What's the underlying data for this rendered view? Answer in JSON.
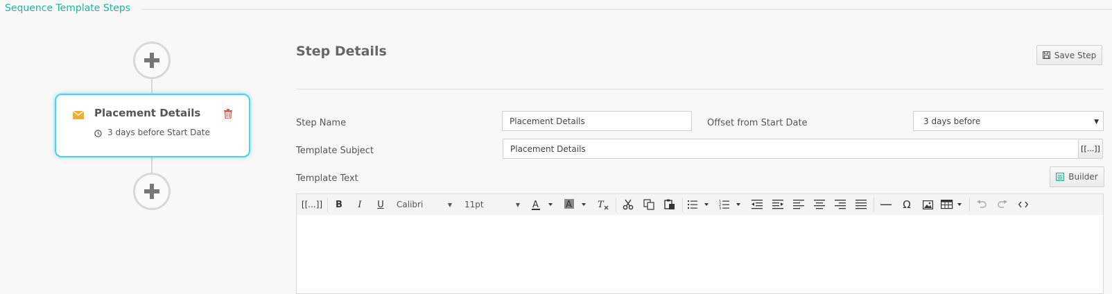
{
  "section": {
    "title": "Sequence Template Steps"
  },
  "steps": [
    {
      "title": "Placement Details",
      "offset_text": "3 days before Start Date"
    }
  ],
  "details": {
    "heading": "Step Details",
    "save_label": "Save Step",
    "step_name_label": "Step Name",
    "step_name_value": "Placement Details",
    "offset_label": "Offset from Start Date",
    "offset_value": "3 days before",
    "subject_label": "Template Subject",
    "subject_value": "Placement Details",
    "merge_label": "[[...]]",
    "text_label": "Template Text",
    "builder_label": "Builder"
  },
  "editor": {
    "merge_label": "[[...]]",
    "font_family": "Calibri",
    "font_size": "11pt"
  },
  "colors": {
    "accent": "#1fb59b",
    "card_border": "#4fd0f0",
    "mail": "#f0ad2e",
    "trash": "#e05a4f"
  },
  "icons": [
    "plus-icon",
    "mail-icon",
    "trash-icon",
    "clock-icon",
    "save-icon",
    "builder-icon",
    "bold-icon",
    "italic-icon",
    "underline-icon",
    "font-color-icon",
    "highlight-icon",
    "clear-format-icon",
    "cut-icon",
    "copy-icon",
    "paste-icon",
    "bullet-list-icon",
    "numbered-list-icon",
    "outdent-icon",
    "indent-icon",
    "align-left-icon",
    "align-center-icon",
    "align-right-icon",
    "justify-icon",
    "horizontal-rule-icon",
    "omega-icon",
    "image-icon",
    "table-icon",
    "undo-icon",
    "redo-icon",
    "code-icon"
  ]
}
